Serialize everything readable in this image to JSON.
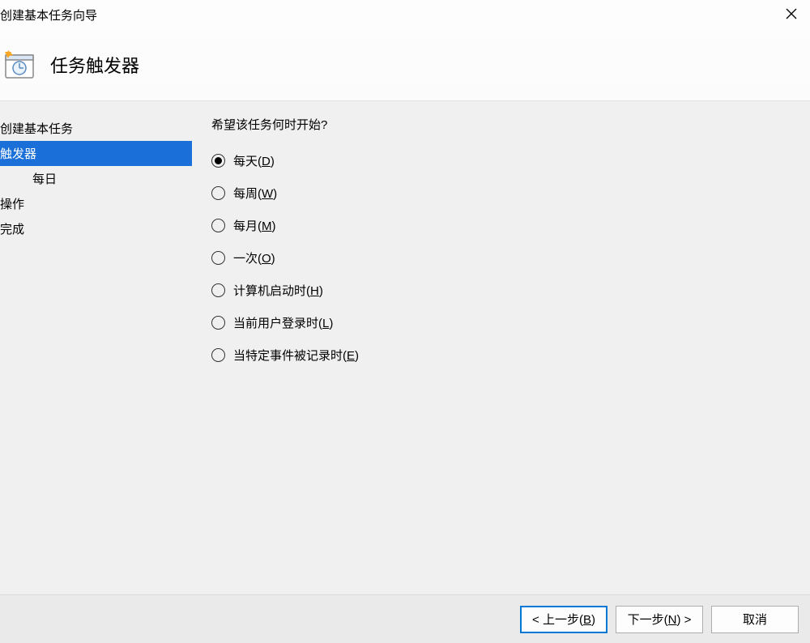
{
  "titlebar": {
    "title": "创建基本任务向导"
  },
  "header": {
    "title": "任务触发器"
  },
  "sidebar": {
    "items": [
      {
        "label": "创建基本任务",
        "selected": false,
        "indent": false
      },
      {
        "label": "触发器",
        "selected": true,
        "indent": false
      },
      {
        "label": "每日",
        "selected": false,
        "indent": true
      },
      {
        "label": "操作",
        "selected": false,
        "indent": false
      },
      {
        "label": "完成",
        "selected": false,
        "indent": false
      }
    ]
  },
  "main": {
    "question": "希望该任务何时开始?",
    "options": [
      {
        "label": "每天",
        "accel": "D",
        "checked": true
      },
      {
        "label": "每周",
        "accel": "W",
        "checked": false
      },
      {
        "label": "每月",
        "accel": "M",
        "checked": false
      },
      {
        "label": "一次",
        "accel": "O",
        "checked": false
      },
      {
        "label": "计算机启动时",
        "accel": "H",
        "checked": false
      },
      {
        "label": "当前用户登录时",
        "accel": "L",
        "checked": false
      },
      {
        "label": "当特定事件被记录时",
        "accel": "E",
        "checked": false
      }
    ]
  },
  "footer": {
    "back": {
      "prefix": "< 上一步(",
      "accel": "B",
      "suffix": ")"
    },
    "next": {
      "prefix": "下一步(",
      "accel": "N",
      "suffix": ") >"
    },
    "cancel": {
      "label": "取消"
    }
  }
}
